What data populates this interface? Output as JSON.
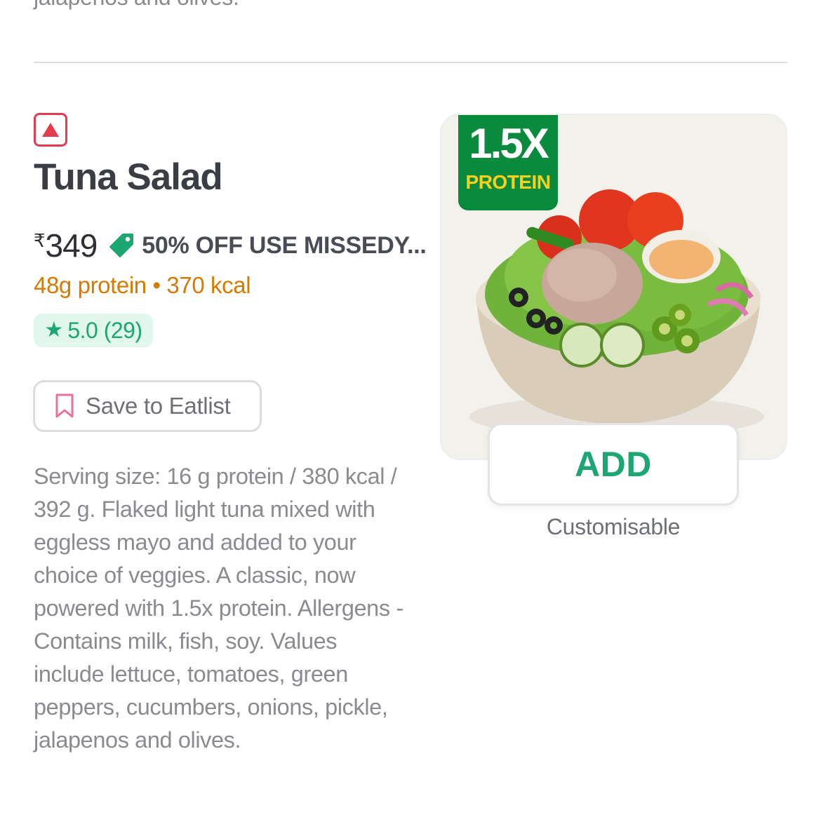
{
  "previous_item": {
    "description_tail": "jalapenos and olives."
  },
  "item": {
    "diet_icon": "non-veg-triangle-icon",
    "name": "Tuna Salad",
    "currency": "₹",
    "price": "349",
    "offer_icon": "discount-tag-icon",
    "offer": "50% OFF USE MISSEDY...",
    "nutrition": "48g protein • 370 kcal",
    "rating": "5.0 (29)",
    "save_label": "Save to Eatlist",
    "description": "Serving size: 16 g protein / 380 kcal / 392 g. Flaked light tuna mixed with eggless mayo and added to your choice of veggies. A classic, now powered with 1.5x protein. Allergens - Contains milk, fish, soy. Values include lettuce, tomatoes, green peppers, cucumbers, onions, pickle, jalapenos and olives.",
    "badge_big": "1.5X",
    "badge_small": "PROTEIN",
    "add_label": "ADD",
    "customisable_label": "Customisable"
  },
  "colors": {
    "accent_green": "#1ba672",
    "nonveg_red": "#e43b4f",
    "nutrition_orange": "#d67a00",
    "badge_green": "#0a8a3c",
    "badge_yellow": "#f7d21c"
  }
}
